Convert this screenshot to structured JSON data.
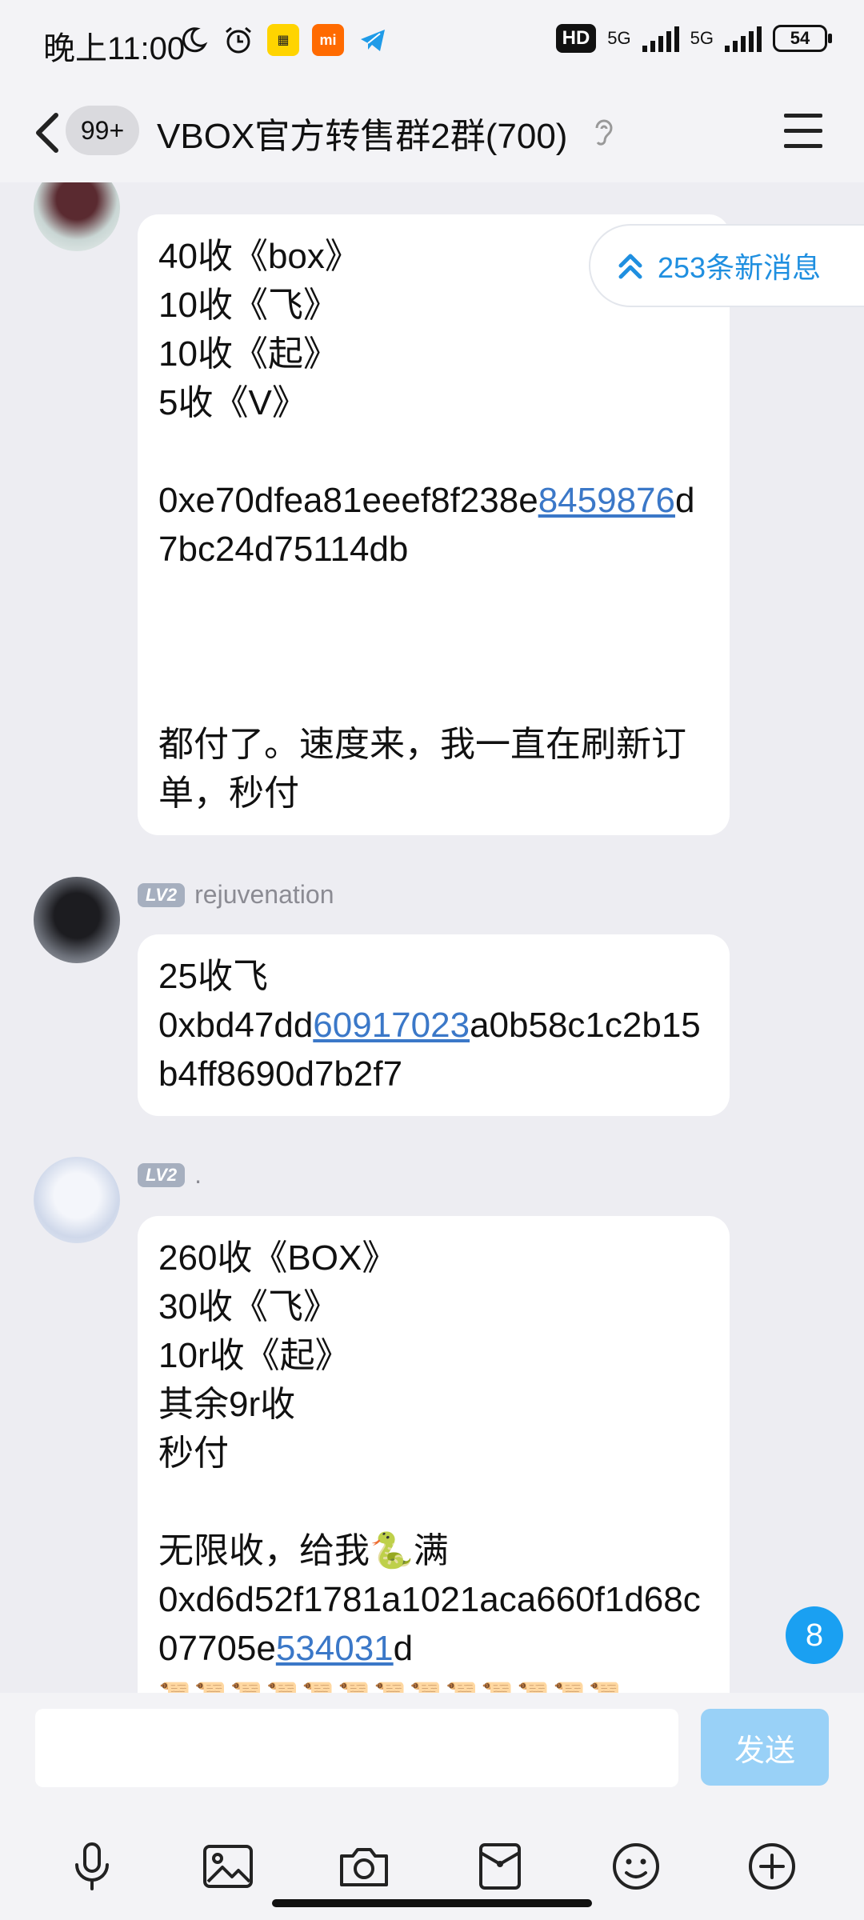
{
  "status_bar": {
    "time": "晚上11:00",
    "icons_left": [
      "moon-icon",
      "alarm-icon",
      "app-icon-yellow",
      "mi-icon",
      "telegram-icon"
    ],
    "hd": "HD",
    "net1": "5G",
    "net2": "5G",
    "battery": "54"
  },
  "header": {
    "unread_badge": "99+",
    "title": "VBOX官方转售群2群(700)"
  },
  "new_messages": {
    "label": "253条新消息"
  },
  "messages": [
    {
      "level": "",
      "username": "",
      "lines": [
        "40收《box》",
        "10收《飞》",
        "10收《起》",
        "5收《V》",
        ""
      ],
      "address": {
        "pre": "0xe70dfea81eeef8f238e",
        "link": "8459876",
        "post": "d7bc24d75114db"
      },
      "tail": [
        "",
        "",
        "",
        "都付了。速度来，我一直在刷新订单，秒付"
      ]
    },
    {
      "level": "LV2",
      "username": "rejuvenation",
      "lines": [
        "25收飞"
      ],
      "address": {
        "pre": "0xbd47dd",
        "link": "60917023",
        "post": "a0b58c1c2b15b4ff8690d7b2f7"
      }
    },
    {
      "level": "LV2",
      "username": ".",
      "lines": [
        "260收《BOX》",
        "30收《飞》",
        "10r收《起》",
        "其余9r收",
        "秒付",
        "",
        "无限收，给我🐍满"
      ],
      "address": {
        "pre": "0xd6d52f1781a1021aca660f1d68c07705e",
        "link": "534031",
        "post": "d"
      },
      "emoji_row": "📜📜📜📜📜📜📜📜📜📜📜📜📜"
    }
  ],
  "unread_count": "8",
  "input": {
    "placeholder": "",
    "send_label": "发送"
  },
  "toolbar": [
    "microphone-icon",
    "image-icon",
    "camera-icon",
    "red-packet-icon",
    "emoji-icon",
    "plus-icon"
  ],
  "colors": {
    "background": "#ededf2",
    "link": "#3b78c8",
    "accent": "#1aa0f2",
    "send_disabled": "#99d1f7"
  }
}
